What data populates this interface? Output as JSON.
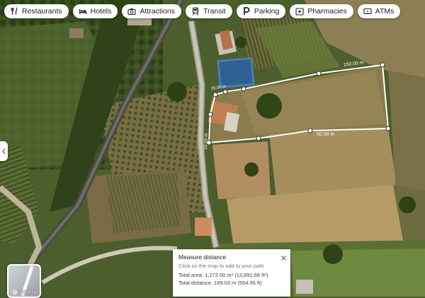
{
  "chips": [
    {
      "label": "Restaurants",
      "icon": "fork-knife-icon"
    },
    {
      "label": "Hotels",
      "icon": "bed-icon"
    },
    {
      "label": "Attractions",
      "icon": "camera-icon"
    },
    {
      "label": "Transit",
      "icon": "train-icon"
    },
    {
      "label": "Parking",
      "icon": "parking-icon"
    },
    {
      "label": "Pharmacies",
      "icon": "pharmacy-icon"
    },
    {
      "label": "ATMs",
      "icon": "atm-icon"
    }
  ],
  "measure": {
    "segments": [
      {
        "label": "150.00 m"
      },
      {
        "label": "50.00 m"
      },
      {
        "label": "15.00 m"
      },
      {
        "label": "10.00 m"
      }
    ]
  },
  "layers": {
    "label": "Layers"
  },
  "card": {
    "title": "Measure distance",
    "hint": "Click on the map to add to your path",
    "area": "Total area: 1,272.00 m² (13,691.66 ft²)",
    "distance": "Total distance: 169.03 m (554.56 ft)"
  },
  "colors": {
    "measure_line": "#ffffff",
    "chip_bg": "#ffffff",
    "text": "#202124"
  }
}
